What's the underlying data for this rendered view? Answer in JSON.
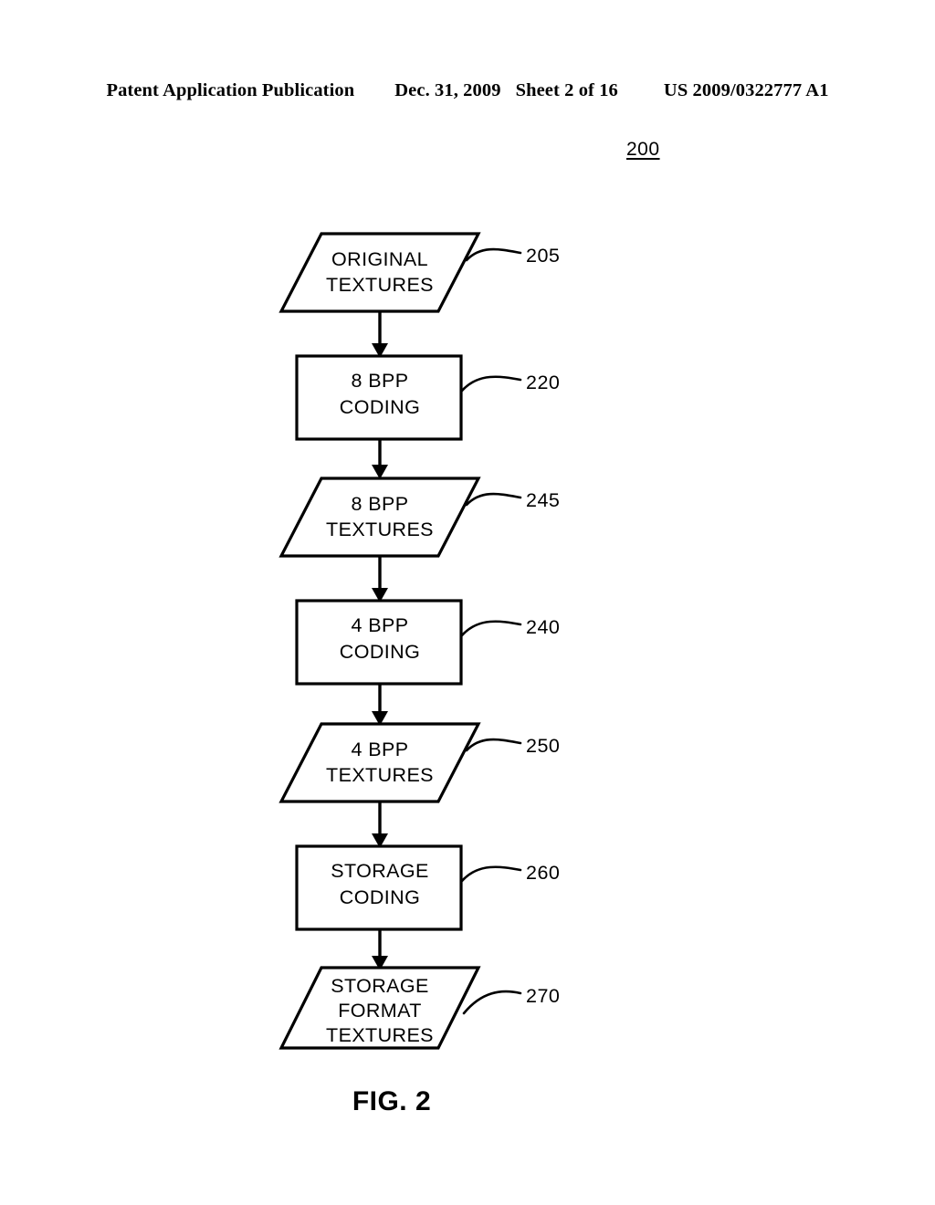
{
  "header": {
    "publication": "Patent Application Publication",
    "date": "Dec. 31, 2009",
    "sheet": "Sheet 2 of 16",
    "patent_number": "US 2009/0322777 A1"
  },
  "figure": {
    "reference_number": "200",
    "caption": "FIG. 2"
  },
  "flow": {
    "nodes": [
      {
        "id": "original-textures",
        "shape": "parallelogram",
        "lines": [
          "ORIGINAL",
          "TEXTURES"
        ],
        "ref": "205"
      },
      {
        "id": "8bpp-coding",
        "shape": "rectangle",
        "lines": [
          "8 BPP",
          "CODING"
        ],
        "ref": "220"
      },
      {
        "id": "8bpp-textures",
        "shape": "parallelogram",
        "lines": [
          "8 BPP",
          "TEXTURES"
        ],
        "ref": "245"
      },
      {
        "id": "4bpp-coding",
        "shape": "rectangle",
        "lines": [
          "4 BPP",
          "CODING"
        ],
        "ref": "240"
      },
      {
        "id": "4bpp-textures",
        "shape": "parallelogram",
        "lines": [
          "4 BPP",
          "TEXTURES"
        ],
        "ref": "250"
      },
      {
        "id": "storage-coding",
        "shape": "rectangle",
        "lines": [
          "STORAGE",
          "CODING"
        ],
        "ref": "260"
      },
      {
        "id": "storage-format-textures",
        "shape": "parallelogram",
        "lines": [
          "STORAGE",
          "FORMAT",
          "TEXTURES"
        ],
        "ref": "270"
      }
    ]
  },
  "colors": {
    "ink": "#000000",
    "paper": "#ffffff"
  }
}
